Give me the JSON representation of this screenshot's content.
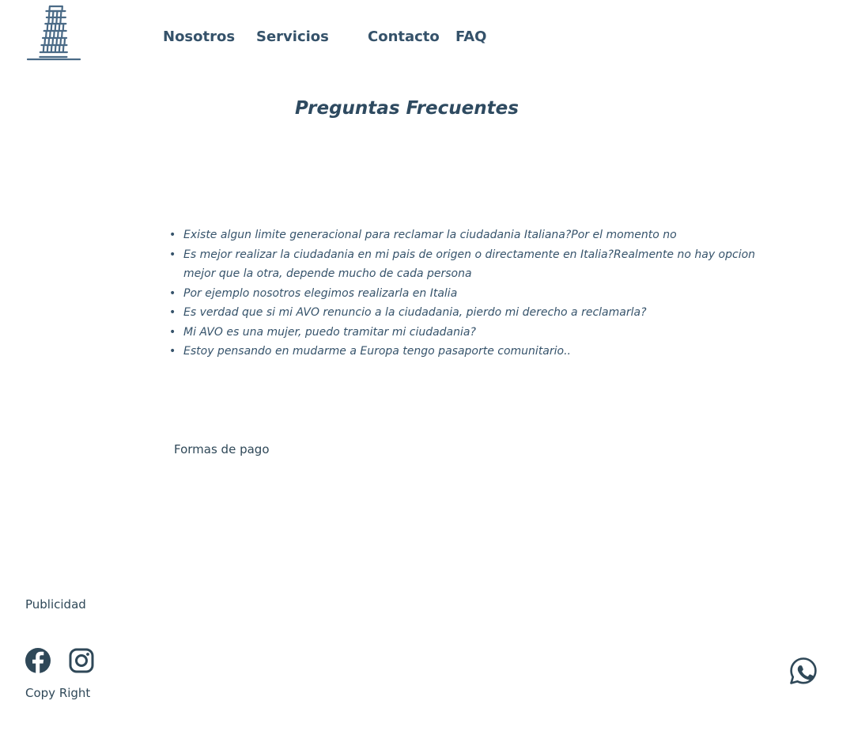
{
  "header": {
    "logo_icon": "leaning-tower-of-pisa-icon",
    "nav": {
      "nosotros": "Nosotros",
      "servicios": "Servicios",
      "contacto": "Contacto",
      "faq": "FAQ"
    }
  },
  "main": {
    "title": "Preguntas Frecuentes",
    "bullet": "•",
    "questions": [
      "Existe algun limite generacional para reclamar la ciudadania Italiana?Por el momento no",
      "Es mejor realizar la ciudadania en mi pais de origen o directamente en Italia?Realmente no hay opcion mejor que la otra, depende mucho de cada persona",
      "Por ejemplo nosotros elegimos realizarla en Italia",
      "Es verdad que si mi AVO renuncio a la ciudadania, pierdo mi derecho a reclamarla?",
      "Mi AVO es una mujer, puedo tramitar mi ciudadania?",
      "Estoy pensando en mudarme a Europa tengo pasaporte comunitario.."
    ],
    "payment_link": "Formas de pago"
  },
  "footer": {
    "publicidad": "Publicidad",
    "copyright": "Copy Right",
    "social_icons": [
      "facebook-icon",
      "instagram-icon"
    ],
    "chat_icon": "whatsapp-icon"
  },
  "colors": {
    "primary": "#2f4858",
    "nav": "#35526a",
    "logo": "#4a6a86"
  }
}
